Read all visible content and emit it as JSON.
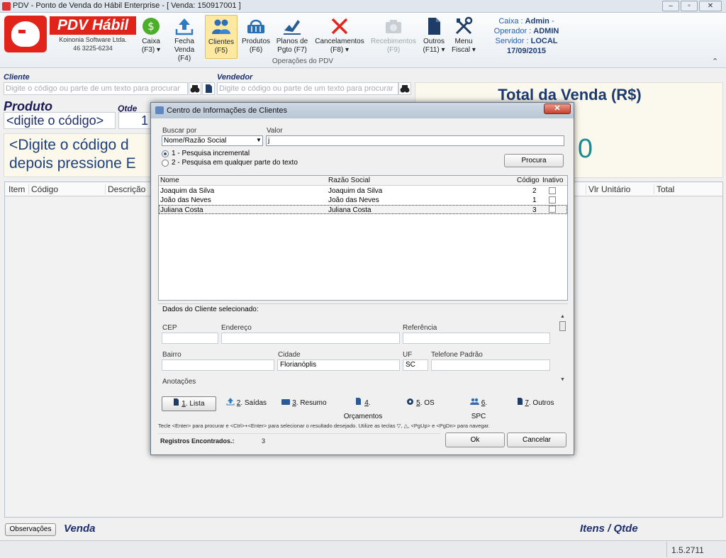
{
  "window": {
    "title": "PDV - Ponto de Venda do Hábil Enterprise - [ Venda: 150917001 ]",
    "min": "‒",
    "max": "▫",
    "close": "✕"
  },
  "brand": {
    "name": "PDV Hábil",
    "company": "Koinonia Software Ltda.",
    "phone": "46 3225-6234"
  },
  "ribbon": {
    "buttons": [
      {
        "label1": "Caixa",
        "label2": "(F3) ▾",
        "icon": "dollar-icon"
      },
      {
        "label1": "Fecha",
        "label2": "Venda (F4)",
        "icon": "upload-icon"
      },
      {
        "label1": "Clientes",
        "label2": "(F5)",
        "icon": "people-icon"
      },
      {
        "label1": "Produtos",
        "label2": "(F6)",
        "icon": "basket-icon"
      },
      {
        "label1": "Planos de",
        "label2": "Pgto (F7)",
        "icon": "sign-icon"
      },
      {
        "label1": "Cancelamentos",
        "label2": "(F8) ▾",
        "icon": "x-icon"
      },
      {
        "label1": "Recebimentos",
        "label2": "(F9)",
        "icon": "camera-icon"
      },
      {
        "label1": "Outros",
        "label2": "(F11) ▾",
        "icon": "document-icon"
      },
      {
        "label1": "Menu",
        "label2": "Fiscal ▾",
        "icon": "tools-icon"
      }
    ],
    "group_label": "Operações do PDV"
  },
  "session": {
    "caixa_label": "Caixa : ",
    "caixa_value": "Admin",
    "operador_label": "Operador : ",
    "operador_value": "ADMIN",
    "servidor_label": "Servidor : ",
    "servidor_value": "LOCAL",
    "date": "17/09/2015",
    "collapse": "⌃"
  },
  "form": {
    "cliente_label": "Cliente",
    "cliente_placeholder": "Digite o código ou parte de um texto para procurar",
    "vendedor_label": "Vendedor",
    "vendedor_placeholder": "Digite o código ou parte de um texto para procurar",
    "produto_label": "Produto",
    "qtde_label": "Qtde",
    "produto_value": "<digite o código>",
    "qtde_value": "1",
    "hint_line1": "<Digite o código d",
    "hint_line2": "depois pressione E",
    "behind_fragment": "T"
  },
  "total": {
    "title": "Total da Venda (R$)",
    "value": "0"
  },
  "grid": {
    "columns": [
      "Item",
      "Código",
      "Descrição",
      "Vlr Unitário",
      "Total"
    ]
  },
  "bottom": {
    "observacoes": "Observações",
    "venda": "Venda",
    "itens_qtde": "Itens / Qtde",
    "version": "1.5.2711"
  },
  "dialog": {
    "title": "Centro de Informações de Clientes",
    "close": "✕",
    "buscar_por_label": "Buscar por",
    "buscar_por_value": "Nome/Razão Social",
    "valor_label": "Valor",
    "valor_value": "j",
    "radio1": "1 - Pesquisa incremental",
    "radio2": "2 - Pesquisa em qualquer parte do texto",
    "procura": "Procura",
    "columns": {
      "nome": "Nome",
      "razao": "Razão Social",
      "codigo": "Código",
      "inativo": "Inativo"
    },
    "rows": [
      {
        "nome": "Joaquim da Silva",
        "razao": "Joaquim da Silva",
        "codigo": "2"
      },
      {
        "nome": "João das Neves",
        "razao": "João das Neves",
        "codigo": "1"
      },
      {
        "nome": "Juliana Costa",
        "razao": "Juliana Costa",
        "codigo": "3"
      }
    ],
    "dados_label": "Dados do Cliente selecionado:",
    "cep_label": "CEP",
    "cep_value": "",
    "endereco_label": "Endereço",
    "endereco_value": "",
    "referencia_label": "Referência",
    "referencia_value": "",
    "bairro_label": "Bairro",
    "bairro_value": "",
    "cidade_label": "Cidade",
    "cidade_value": "Florianóplis",
    "uf_label": "UF",
    "uf_value": "SC",
    "telefone_label": "Telefone Padrão",
    "telefone_value": "",
    "anotacoes_label": "Anotações",
    "tabs": [
      {
        "key": "1",
        "label": ". Lista"
      },
      {
        "key": "2",
        "label": ". Saídas"
      },
      {
        "key": "3",
        "label": ". Resumo"
      },
      {
        "key": "4",
        "label": ". Orçamentos"
      },
      {
        "key": "5",
        "label": ". OS"
      },
      {
        "key": "6",
        "label": ". SPC"
      },
      {
        "key": "7",
        "label": ". Outros"
      }
    ],
    "help_text": "Tecle <Enter> para procurar e <Ctrl>+<Enter> para selecionar o resultado desejado. Utilize as teclas ▽, △, <PgUp> e <PgDn> para navegar.",
    "registros_label": "Registros Encontrados.:",
    "registros_value": "3",
    "ok": "Ok",
    "cancelar": "Cancelar"
  }
}
